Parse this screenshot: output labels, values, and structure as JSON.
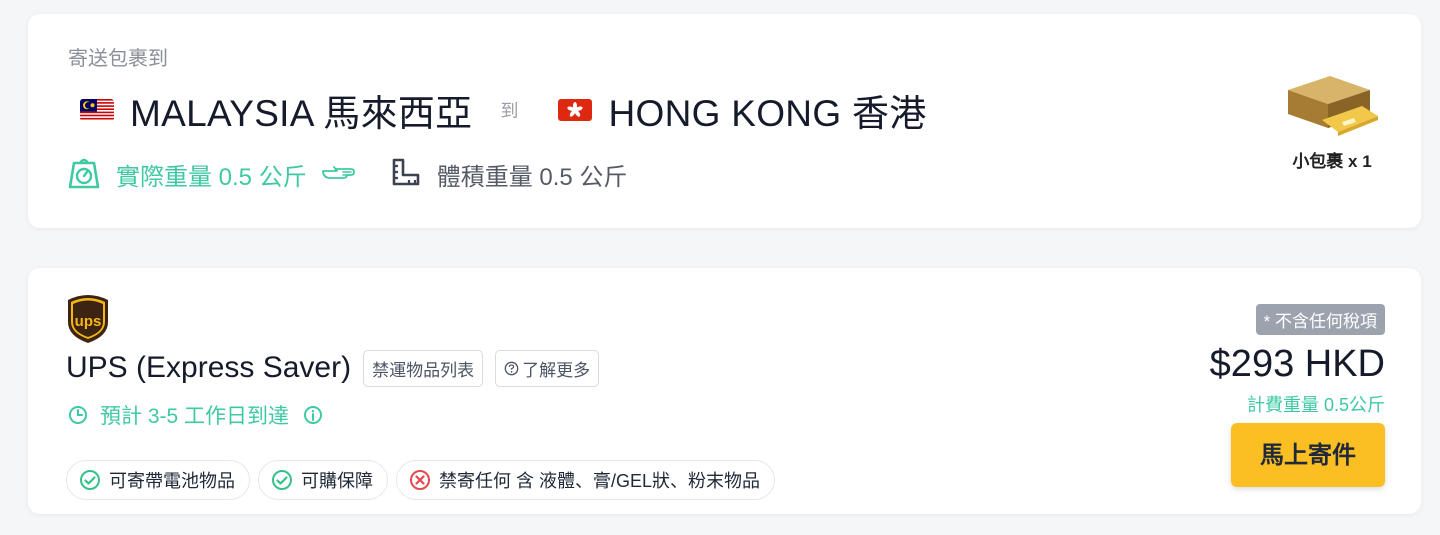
{
  "shipment": {
    "subtitle": "寄送包裹到",
    "origin": "MALAYSIA 馬來西亞",
    "to_word": "到",
    "destination": "HONG KONG 香港",
    "actual_weight": "實際重量 0.5 公斤",
    "volumetric_weight": "體積重量 0.5 公斤",
    "package_label": "小包裹 x 1",
    "accent_color": "#3ec9a4"
  },
  "quote": {
    "carrier": "UPS (Express Saver)",
    "prohibited_btn": "禁運物品列表",
    "learn_more_btn": "了解更多",
    "eta": "預計 3-5 工作日到達",
    "features": [
      {
        "label": "可寄帶電池物品",
        "status": "allowed"
      },
      {
        "label": "可購保障",
        "status": "allowed"
      },
      {
        "label": "禁寄任何 含 液體、膏/GEL狀、粉末物品",
        "status": "forbidden"
      }
    ],
    "tax_note": "* 不含任何稅項",
    "price": "$293 HKD",
    "billed_weight": "計費重量 0.5公斤",
    "ship_btn": "馬上寄件",
    "button_color": "#fbbf24"
  }
}
